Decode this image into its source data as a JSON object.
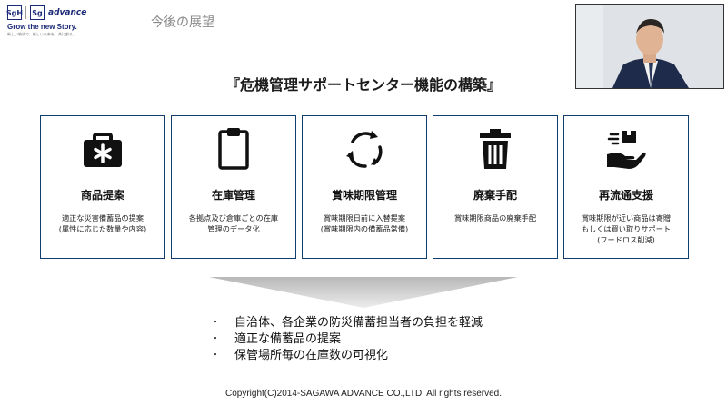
{
  "logo": {
    "mark_left": "SgH",
    "mark_right": "Sg",
    "brand": "advance",
    "tagline": "Grow the new Story.",
    "subline": "新しい物流で、新しい未来を、共に創る。"
  },
  "header": {
    "title": "今後の展望"
  },
  "main_title": "『危機管理サポートセンター機能の構築』",
  "cards": [
    {
      "icon": "first-aid-kit-icon",
      "title": "商品提案",
      "desc": [
        "適正な災害備蓄品の提案",
        "(属性に応じた数量や内容)"
      ]
    },
    {
      "icon": "clipboard-icon",
      "title": "在庫管理",
      "desc": [
        "各拠点及び倉庫ごとの在庫",
        "管理のデータ化"
      ]
    },
    {
      "icon": "refresh-cycle-icon",
      "title": "賞味期限管理",
      "desc": [
        "賞味期限日前に入替提案",
        "(賞味期限内の備蓄品常備)"
      ]
    },
    {
      "icon": "trash-bin-icon",
      "title": "廃棄手配",
      "desc": [
        "賞味期限商品の廃棄手配"
      ]
    },
    {
      "icon": "hand-with-box-icon",
      "title": "再流通支援",
      "desc": [
        "賞味期限が近い商品は寄贈",
        "もしくは買い取りサポート",
        "(フードロス削減)"
      ]
    }
  ],
  "bullets": [
    "自治体、各企業の防災備蓄担当者の負担を軽減",
    "適正な備蓄品の提案",
    "保管場所毎の在庫数の可視化"
  ],
  "bullet_marker": "・",
  "copyright": "Copyright(C)2014-SAGAWA ADVANCE CO.,LTD. All rights reserved.",
  "colors": {
    "card_border": "#0f3d6e",
    "brand_navy": "#1b2a78",
    "icon": "#111111"
  }
}
